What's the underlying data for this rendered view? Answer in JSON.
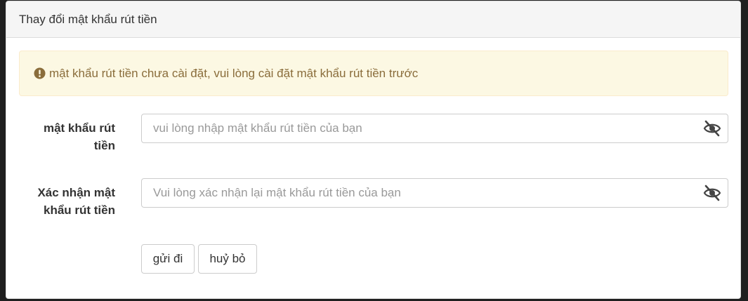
{
  "panel": {
    "title": "Thay đổi mật khẩu rút tiền"
  },
  "alert": {
    "icon": "exclamation-circle-icon",
    "message": "mật khẩu rút tiền chưa cài đặt, vui lòng cài đặt mật khẩu rút tiền trước",
    "text_color": "#8a6d3b",
    "background": "#fcf8e3"
  },
  "form": {
    "password": {
      "label_line1": "mật khẩu rút",
      "label_line2": "tiền",
      "placeholder": "vui lòng nhập mật khẩu rút tiền của bạn",
      "value": "",
      "toggle_icon": "eye-slash-icon"
    },
    "confirm": {
      "label_line1": "Xác nhận mật",
      "label_line2": "khẩu rút tiền",
      "placeholder": "Vui lòng xác nhận lại mật khẩu rút tiền của bạn",
      "value": "",
      "toggle_icon": "eye-slash-icon"
    }
  },
  "buttons": {
    "submit_label": "gửi đi",
    "cancel_label": "huỷ bỏ"
  }
}
